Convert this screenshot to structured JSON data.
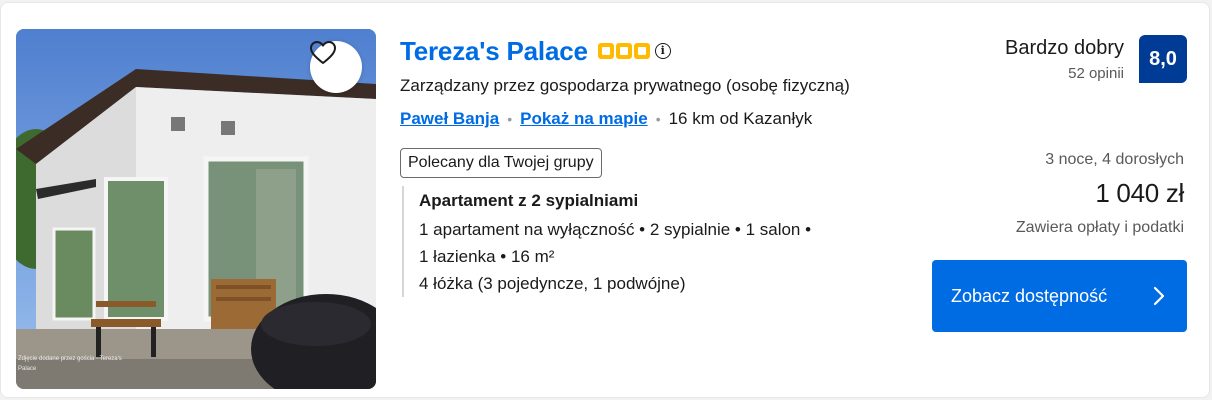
{
  "property": {
    "name": "Tereza's Palace",
    "stars": 3,
    "host_type": "Zarządzany przez gospodarza prywatnego (osobę fizyczną)",
    "location_link": "Paweł Banja",
    "map_link": "Pokaż na mapie",
    "distance": "16 km od Kazanłyk",
    "badge": "Polecany dla Twojej grupy",
    "photo_watermark": "Zdjęcie dodane przez gościa · Tereza's Palace"
  },
  "unit": {
    "title": "Apartament z 2 sypialniami",
    "lines": [
      "1 apartament na wyłączność • 2 sypialnie • 1 salon •",
      "1 łazienka • 16 m²",
      "4 łóżka (3 pojedyncze, 1 podwójne)"
    ]
  },
  "review": {
    "label": "Bardzo dobry",
    "count": "52 opinii",
    "score": "8,0"
  },
  "pricing": {
    "stay": "3 noce, 4 dorosłych",
    "price": "1 040 zł",
    "taxes": "Zawiera opłaty i podatki"
  },
  "cta": {
    "label": "Zobacz dostępność"
  },
  "colors": {
    "link": "#006ce4",
    "score_bg": "#003b95",
    "star": "#febb02",
    "cta_bg": "#006ce4"
  },
  "icons": {
    "favorite": "heart-icon",
    "info": "info-icon",
    "cta_arrow": "chevron-right-icon"
  }
}
